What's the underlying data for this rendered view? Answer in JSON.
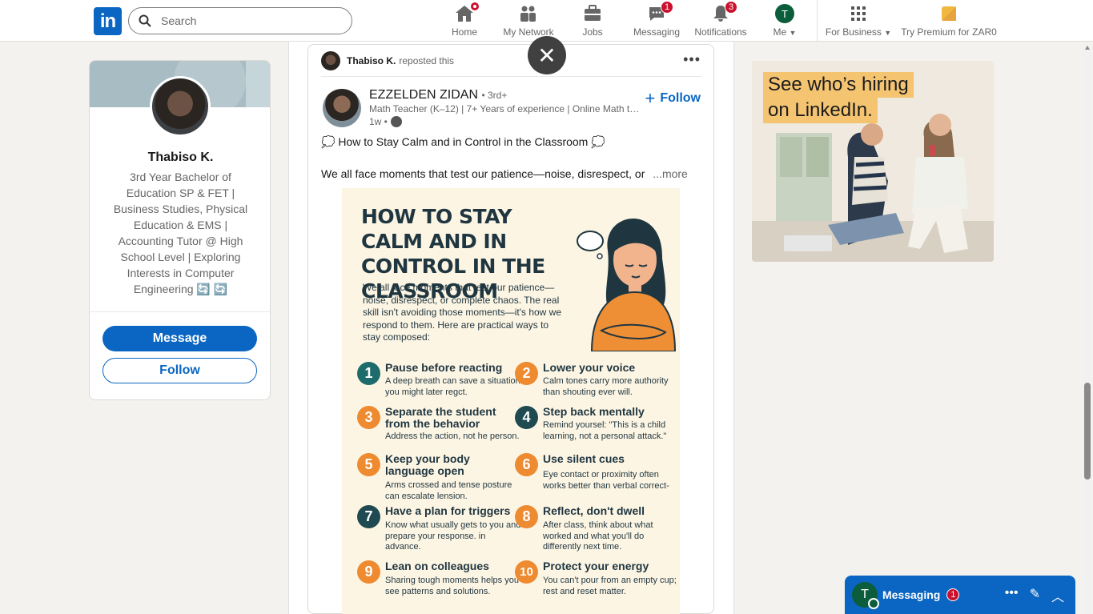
{
  "nav": {
    "search_placeholder": "Search",
    "items": [
      {
        "label": "Home",
        "icon": "home-icon"
      },
      {
        "label": "My Network",
        "icon": "network-icon"
      },
      {
        "label": "Jobs",
        "icon": "briefcase-icon"
      },
      {
        "label": "Messaging",
        "icon": "messaging-icon",
        "badge": "1"
      },
      {
        "label": "Notifications",
        "icon": "bell-icon",
        "badge": "3"
      },
      {
        "label": "Me",
        "icon": "avatar",
        "avatar_initial": "T"
      },
      {
        "label": "For Business",
        "icon": "grid-icon"
      },
      {
        "label": "Try Premium for ZAR0",
        "icon": "premium-icon"
      }
    ]
  },
  "profile": {
    "name": "Thabiso K.",
    "headline": "3rd Year Bachelor of Education SP & FET | Business Studies, Physical Education & EMS | Accounting Tutor @ High School Level | Exploring Interests in Computer Engineering 🔄 🔄",
    "message_label": "Message",
    "follow_label": "Follow"
  },
  "post": {
    "reposter": "Thabiso K.",
    "repost_text": "reposted this",
    "author_name": "EZZELDEN ZIDAN",
    "author_degree": "• 3rd+",
    "author_subtitle": "Math Teacher (K–12) | 7+ Years of experience | Online Math tut...",
    "time": "1w •",
    "follow_label": "Follow",
    "title": "💭 How to Stay Calm and in Control in the Classroom 💭",
    "body": "We all face moments that test our patience—noise, disrespect, or",
    "more": "...more"
  },
  "infographic": {
    "title": "HOW TO STAY CALM AND IN CONTROL IN THE CLASSROOM",
    "intro": "We all face moments that test our patience—noise, disrespect, or complete chaos. The real skill isn't avoiding those moments—it's how we respond to them. Here are practical ways to stay composed:",
    "tips": [
      {
        "n": "1",
        "title": "Pause before reacting",
        "desc": "A deep breath can save a situation you might later regct.",
        "color": "#1e6b6b"
      },
      {
        "n": "2",
        "title": "Lower your voice",
        "desc": "Calm tones carry more authority than shouting ever will.",
        "color": "#ee8a2f"
      },
      {
        "n": "3",
        "title": "Separate the student from the behavior",
        "desc": "Address the action, not he person.",
        "color": "#ee8a2f"
      },
      {
        "n": "4",
        "title": "Step back mentally",
        "desc": "Remind yoursel: \"This is a child learning, not a personal attack.\"",
        "color": "#1f4a52"
      },
      {
        "n": "5",
        "title": "Keep your body language open",
        "desc": "Arms crossed and tense posture can escalate lension.",
        "color": "#ee8a2f"
      },
      {
        "n": "6",
        "title": "Use silent cues",
        "desc": "Eye contact or proximity often works better than verbal correct-",
        "color": "#ee8a2f"
      },
      {
        "n": "7",
        "title": "Have a plan for triggers",
        "desc": "Know what usually gets to you and prepare your response. in advance.",
        "color": "#1f4a52"
      },
      {
        "n": "8",
        "title": "Reflect, don't dwell",
        "desc": "After class, think about what worked and what you'll do differently next time.",
        "color": "#ee8a2f"
      },
      {
        "n": "9",
        "title": "Lean on colleagues",
        "desc": "Sharing tough moments helps you see patterns and solutions.",
        "color": "#ee8a2f"
      },
      {
        "n": "10",
        "title": "Protect your energy",
        "desc": "You can't pour from an empty cup; rest and reset matter.",
        "color": "#ee8a2f"
      }
    ]
  },
  "ad": {
    "line1": "See who’s hiring",
    "line2": "on LinkedIn."
  },
  "messaging": {
    "title": "Messaging",
    "badge": "1",
    "avatar_initial": "T"
  },
  "colors": {
    "brand": "#0a66c2",
    "badge": "#cb112d"
  }
}
